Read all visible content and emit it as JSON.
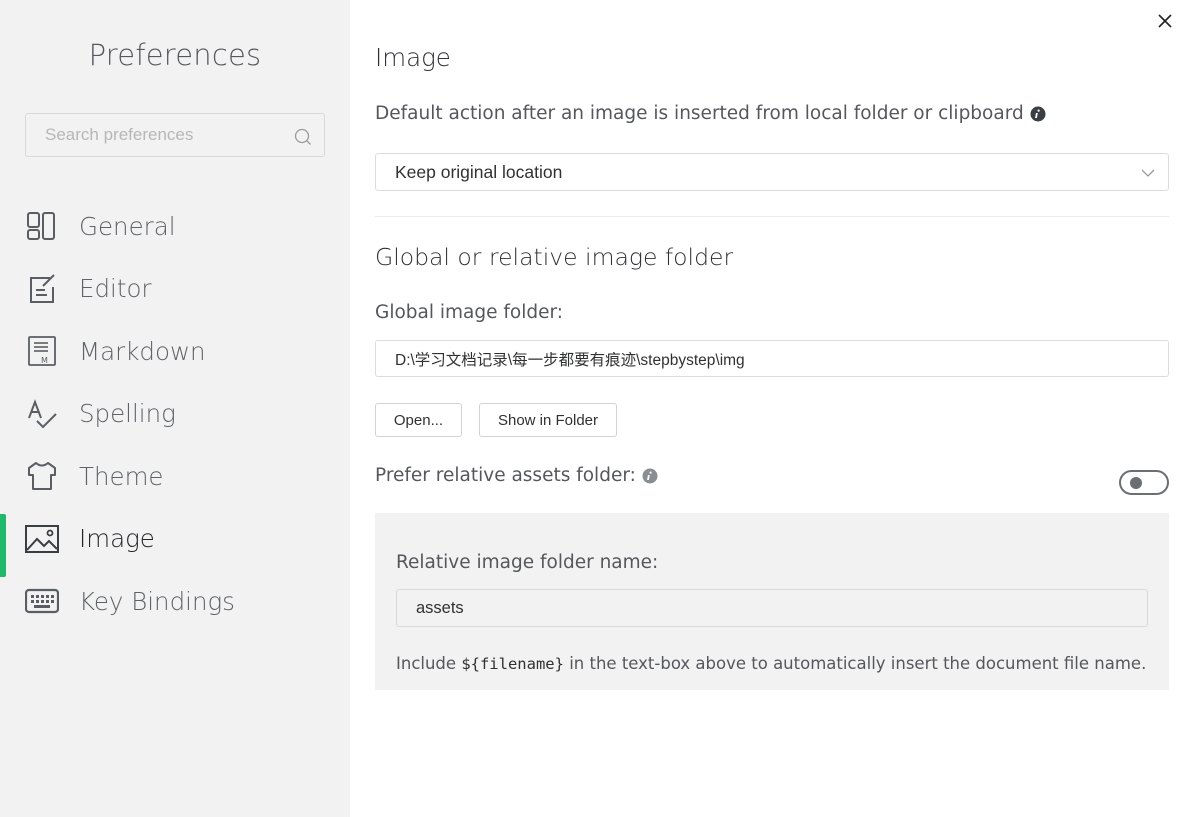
{
  "sidebar": {
    "title": "Preferences",
    "search_placeholder": "Search preferences",
    "items": [
      {
        "label": "General",
        "icon": "general-icon",
        "active": false
      },
      {
        "label": "Editor",
        "icon": "editor-icon",
        "active": false
      },
      {
        "label": "Markdown",
        "icon": "markdown-icon",
        "active": false
      },
      {
        "label": "Spelling",
        "icon": "spelling-icon",
        "active": false
      },
      {
        "label": "Theme",
        "icon": "theme-icon",
        "active": false
      },
      {
        "label": "Image",
        "icon": "image-icon",
        "active": true
      },
      {
        "label": "Key Bindings",
        "icon": "keyboard-icon",
        "active": false
      }
    ]
  },
  "main": {
    "title": "Image",
    "default_action": {
      "description": "Default action after an image is inserted from local folder or clipboard",
      "selected": "Keep original location"
    },
    "folder_section": {
      "title": "Global or relative image folder",
      "global_label": "Global image folder:",
      "global_path": "D:\\学习文档记录\\每一步都要有痕迹\\stepbystep\\img",
      "open_button": "Open...",
      "show_button": "Show in Folder",
      "prefer_relative_label": "Prefer relative assets folder:",
      "prefer_relative_enabled": false,
      "relative_label": "Relative image folder name:",
      "relative_value": "assets",
      "note_prefix": "Include ",
      "note_code": "${filename}",
      "note_suffix": " in the text-box above to automatically insert the document file name."
    }
  },
  "colors": {
    "accent": "#20b86a",
    "sidebar_bg": "#f2f2f2"
  }
}
